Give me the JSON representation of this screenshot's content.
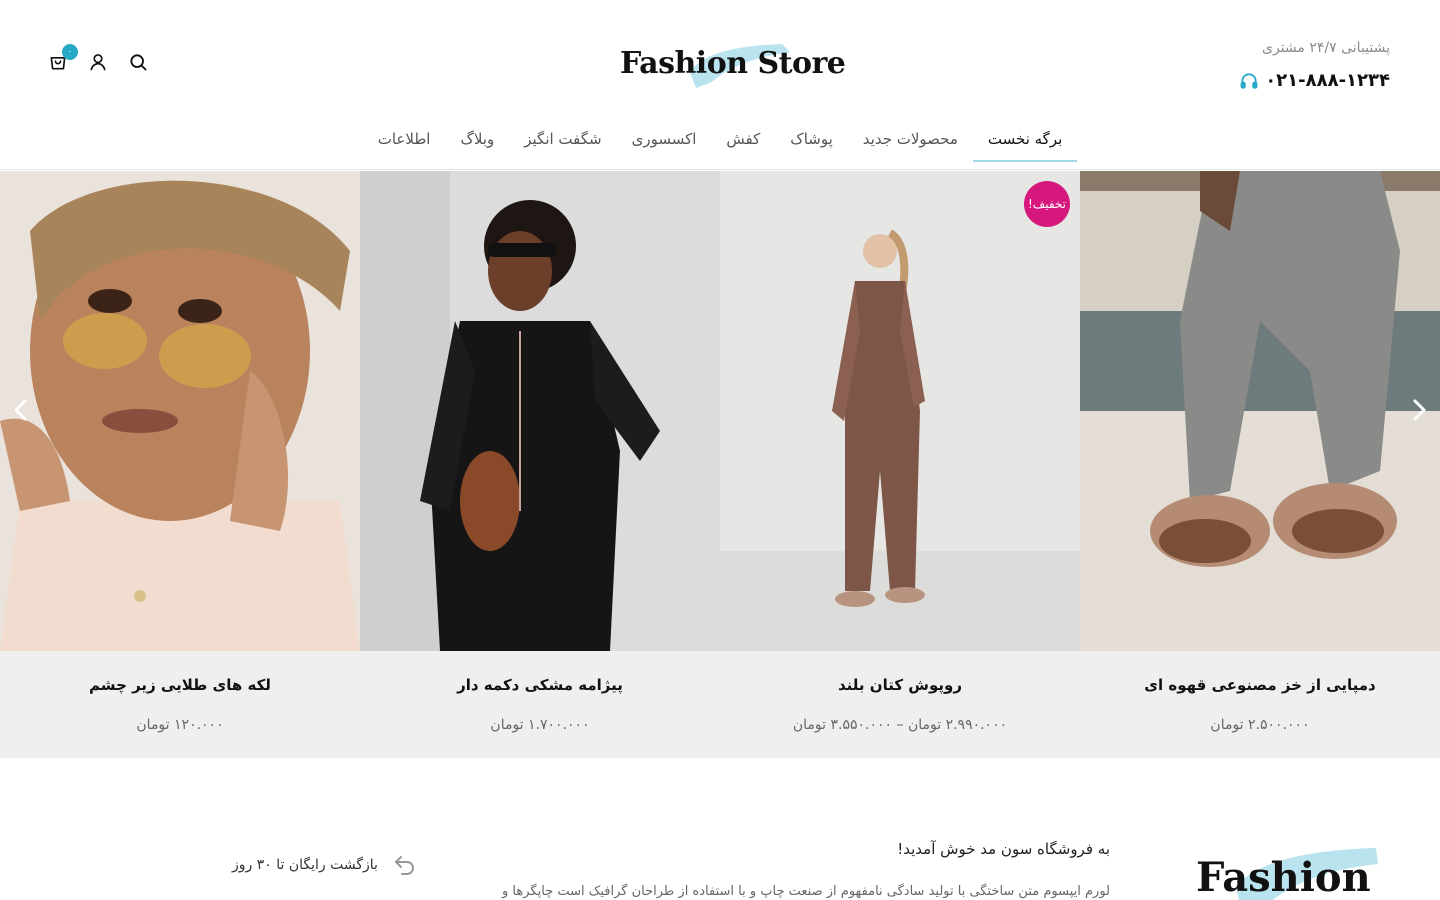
{
  "header": {
    "support_label": "پشتیبانی ۲۴/۷ مشتری",
    "phone": "۰۲۱-۸۸۸-۱۲۳۴",
    "logo_text": "Fashion Store",
    "cart_count": "۰"
  },
  "nav": {
    "items": [
      {
        "label": "برگه نخست"
      },
      {
        "label": "محصولات جدید"
      },
      {
        "label": "پوشاک"
      },
      {
        "label": "کفش"
      },
      {
        "label": "اکسسوری"
      },
      {
        "label": "شگفت انگیز"
      },
      {
        "label": "وبلاگ"
      },
      {
        "label": "اطلاعات"
      }
    ],
    "active_index": 0
  },
  "products": [
    {
      "title": "دمپایی از خز مصنوعی قهوه ای",
      "price": "۲.۵۰۰.۰۰۰ تومان"
    },
    {
      "title": "روپوش کتان بلند",
      "price": "۲.۹۹۰.۰۰۰ تومان – ۳.۵۵۰.۰۰۰ تومان",
      "badge": "تخفیف!"
    },
    {
      "title": "پیژامه مشکی دکمه دار",
      "price": "۱.۷۰۰.۰۰۰ تومان"
    },
    {
      "title": "لکه های طلایی زیر چشم",
      "price": "۱۲۰.۰۰۰ تومان"
    }
  ],
  "info": {
    "welcome_title": "به فروشگاه سون مد خوش آمدید!",
    "welcome_text": "لورم ایپسوم متن ساختگی با تولید سادگی نامفهوم از صنعت چاپ و با استفاده از طراحان گرافیک است چاپگرها و",
    "return_text": "بازگشت رایگان تا ۳۰ روز",
    "footer_logo_text": "Fashion"
  },
  "colors": {
    "accent": "#27a9c6",
    "brush": "#b9e3ee",
    "sale": "#d6187e",
    "card_bg": "#efefef"
  },
  "icons": {
    "header": [
      "cart-icon",
      "user-icon",
      "search-icon"
    ],
    "phone": "headset-icon",
    "slider": [
      "chevron-left-icon",
      "chevron-right-icon"
    ],
    "return": "return-arrow-icon"
  }
}
